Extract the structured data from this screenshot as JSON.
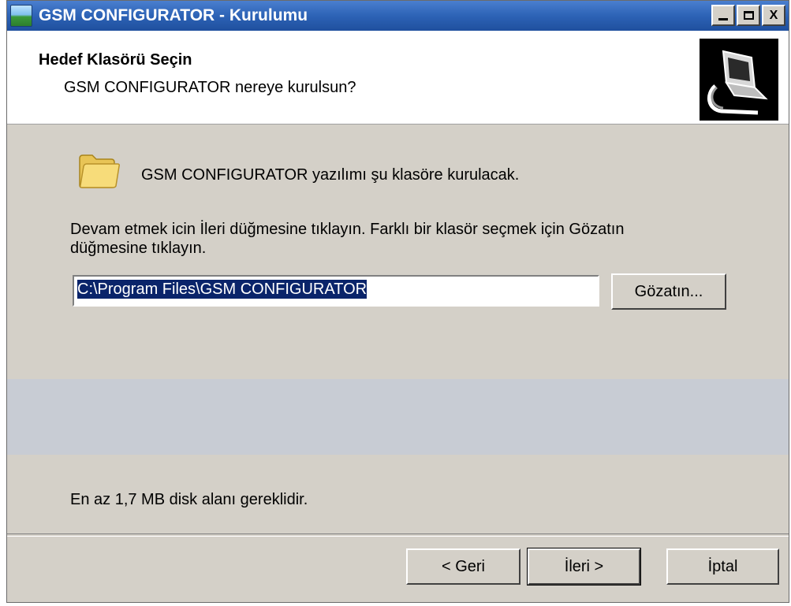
{
  "window": {
    "title": "GSM CONFIGURATOR - Kurulumu",
    "controls": {
      "minimize_icon": "minimize-icon",
      "maximize_icon": "maximize-icon",
      "close_label": "X"
    }
  },
  "header": {
    "title": "Hedef Klasörü Seçin",
    "subtitle": "GSM CONFIGURATOR nereye kurulsun?",
    "image_icon": "computer-install-icon"
  },
  "body": {
    "folder_icon": "folder-icon",
    "info_line": "GSM CONFIGURATOR yazılımı şu klasöre kurulacak.",
    "instruction": "Devam etmek icin İleri düğmesine tıklayın. Farklı bir klasör seçmek için Gözatın düğmesine tıklayın.",
    "path_value": "C:\\Program Files\\GSM CONFIGURATOR",
    "browse_label": "Gözatın...",
    "disk_space": "En az 1,7 MB disk alanı gereklidir."
  },
  "footer": {
    "back_label": "< Geri",
    "next_label": "İleri >",
    "cancel_label": "İptal"
  },
  "colors": {
    "titlebar": "#2d63b6",
    "dialog_bg": "#d4d0c8",
    "selection": "#0a246a"
  }
}
